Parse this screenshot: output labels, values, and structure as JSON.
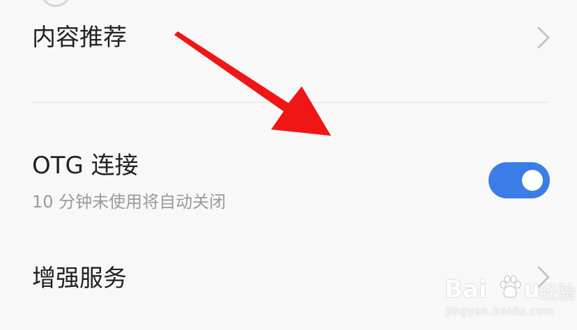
{
  "settings": {
    "content_recommend": {
      "label": "内容推荐"
    },
    "otg": {
      "label": "OTG 连接",
      "subtitle": "10 分钟未使用将自动关闭",
      "enabled": true
    },
    "enhanced_service": {
      "label": "增强服务"
    }
  },
  "watermark": {
    "brand_left": "Bai",
    "brand_right": "u",
    "brand_cn": "经验",
    "url": "jingyan.baidu.com"
  },
  "colors": {
    "toggle_on": "#3b7de6",
    "annotation_arrow": "#f01616",
    "background": "#f8f8f8"
  }
}
